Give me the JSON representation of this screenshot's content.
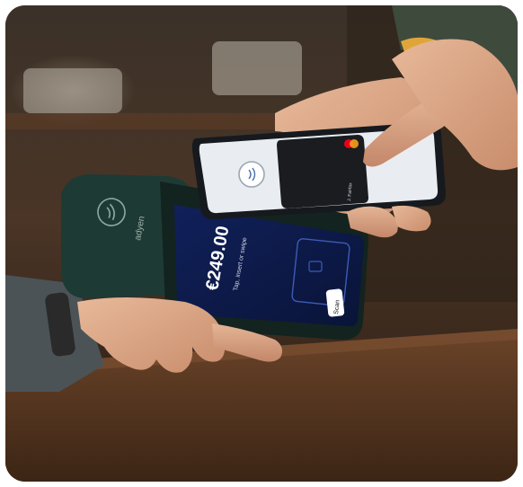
{
  "photo": {
    "subject": "contactless-payment-scene",
    "terminal": {
      "brand_logo": "adyen",
      "amount": "€249.00",
      "prompt": "Tap, insert or swipe",
      "button_label": "Scan",
      "contactless_icon": "contactless-icon"
    },
    "phone": {
      "card_name": "J. Fairfax",
      "contactless_icon": "contactless-icon",
      "card_network_icon": "mastercard-logo"
    },
    "colors": {
      "terminal_body": "#1f3a33",
      "terminal_screen": "#0b1a4a",
      "phone_screen": "#e9edf1",
      "counter_wood": "#5a3a24"
    }
  }
}
